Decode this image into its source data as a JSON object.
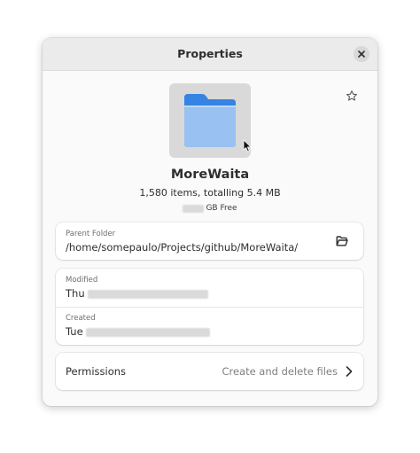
{
  "window": {
    "title": "Properties"
  },
  "file": {
    "name": "MoreWaita",
    "summary": "1,580 items, totalling 5.4 MB",
    "free_suffix": "GB Free"
  },
  "parent_folder": {
    "caption": "Parent Folder",
    "path": "/home/somepaulo/Projects/github/MoreWaita/"
  },
  "modified": {
    "caption": "Modified",
    "day": "Thu"
  },
  "created": {
    "caption": "Created",
    "day": "Tue"
  },
  "permissions": {
    "label": "Permissions",
    "value": "Create and delete files"
  },
  "icons": {
    "close": "close-icon",
    "star": "star-icon",
    "folder": "folder-icon",
    "open_folder": "open-folder-icon",
    "chevron": "chevron-right-icon"
  },
  "colors": {
    "folder_front": "#99c1f1",
    "folder_back": "#3584e4",
    "preview_bg": "#d9d9d9"
  }
}
